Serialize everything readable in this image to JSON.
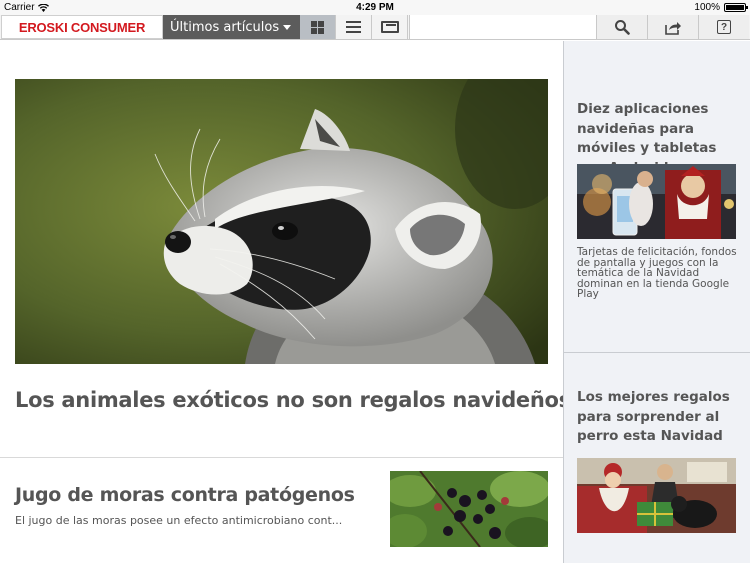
{
  "status": {
    "carrier": "Carrier",
    "time": "4:29 PM",
    "battery": "100%"
  },
  "navbar": {
    "brand": "EROSKI CONSUMER",
    "section": "Últimos artículos",
    "icons": [
      "grid-view-icon",
      "list-view-icon",
      "magazine-view-icon",
      "search-icon",
      "share-icon",
      "help-icon"
    ],
    "help_glyph": "?"
  },
  "feed": {
    "hero": {
      "title": "Los animales exóticos no son regalos navideños",
      "image": "raccoon-photo"
    },
    "article2": {
      "title": "Jugo de moras contra patógenos",
      "excerpt": "El jugo de las moras posee un efecto antimicrobiano cont...",
      "image": "blackberries-photo"
    }
  },
  "sidebar": {
    "items": [
      {
        "title": "Diez aplicaciones navideñas para móviles y tabletas con Android",
        "text": "Tarjetas de felicitación, fondos de pantalla y juegos con la temática de la Navidad dominan en la tienda Google Play",
        "image": "santa-phone-photo"
      },
      {
        "title": "Los mejores regalos para sorprender al perro esta Navidad",
        "image": "dog-gift-photo"
      }
    ]
  },
  "colors": {
    "brand_red": "#d3191f",
    "section_bg": "#5c5c5c",
    "sidebar_bg": "#f0f2f6",
    "title_gray": "#555555"
  }
}
